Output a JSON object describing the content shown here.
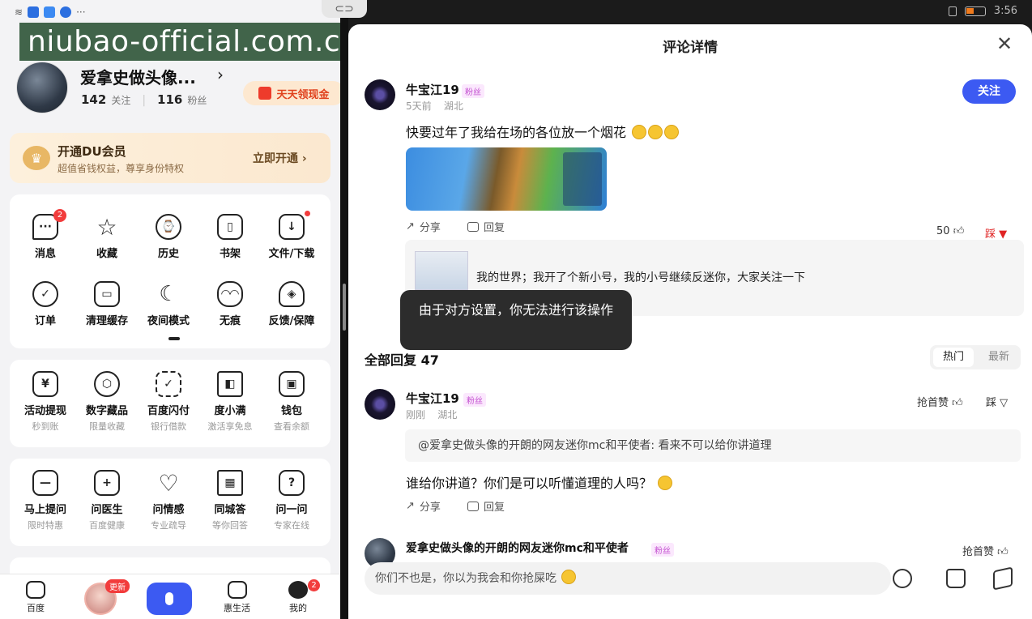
{
  "left": {
    "watermark": "niubao-official.com.cn",
    "profile": {
      "name": "爱拿史做头像...",
      "follow_count": "142",
      "follow_label": "关注",
      "fans_count": "116",
      "fans_label": "粉丝",
      "cash_label": "天天领现金"
    },
    "vip": {
      "title": "开通DU会员",
      "subtitle": "超值省钱权益，尊享身份特权",
      "button": "立即开通 ›"
    },
    "tools": [
      {
        "label": "消息",
        "icon": "message-icon",
        "badge": "2"
      },
      {
        "label": "收藏",
        "icon": "star-icon"
      },
      {
        "label": "历史",
        "icon": "clock-icon"
      },
      {
        "label": "书架",
        "icon": "bookshelf-icon"
      },
      {
        "label": "文件/下载",
        "icon": "download-icon",
        "dot": true
      },
      {
        "label": "订单",
        "icon": "order-icon"
      },
      {
        "label": "清理缓存",
        "icon": "clean-icon"
      },
      {
        "label": "夜间模式",
        "icon": "moon-icon"
      },
      {
        "label": "无痕",
        "icon": "mask-icon"
      },
      {
        "label": "反馈/保障",
        "icon": "feedback-icon"
      }
    ],
    "finance": [
      {
        "label": "活动提现",
        "sub": "秒到账",
        "icon": "withdraw-icon"
      },
      {
        "label": "数字藏品",
        "sub": "限量收藏",
        "icon": "cube-icon"
      },
      {
        "label": "百度闪付",
        "sub": "银行借款",
        "icon": "scan-icon"
      },
      {
        "label": "度小满",
        "sub": "激活享免息",
        "icon": "duxiaoman-icon"
      },
      {
        "label": "钱包",
        "sub": "查看余额",
        "icon": "wallet-icon"
      }
    ],
    "ask": [
      {
        "label": "马上提问",
        "sub": "限时特惠",
        "icon": "ask-icon"
      },
      {
        "label": "问医生",
        "sub": "百度健康",
        "icon": "doctor-icon"
      },
      {
        "label": "问情感",
        "sub": "专业疏导",
        "icon": "heart-icon"
      },
      {
        "label": "同城答",
        "sub": "等你回答",
        "icon": "building-icon"
      },
      {
        "label": "问一问",
        "sub": "专家在线",
        "icon": "question-icon"
      }
    ],
    "bottom_nav": {
      "home": "百度",
      "new_badge": "更新",
      "life": "惠生活",
      "mine": "我的",
      "mine_badge": "2"
    }
  },
  "status": {
    "time": "3:56"
  },
  "right": {
    "title": "评论详情",
    "post": {
      "author": "牛宝江19",
      "fan_tag": "粉丝",
      "time": "5天前",
      "location": "湖北",
      "follow_button": "关注",
      "text": "快要过年了我给在场的各位放一个烟花",
      "share": "分享",
      "reply": "回复",
      "likes": "50",
      "dislike": "踩",
      "quote": "我的世界；我开了个新小号，我的小号继续反迷你，大家关注一下"
    },
    "toast": "由于对方设置，你无法进行该操作",
    "all_replies_label": "全部回复",
    "all_replies_count": "47",
    "sort": {
      "hot": "热门",
      "new": "最新"
    },
    "reply1": {
      "author": "牛宝江19",
      "fan_tag": "粉丝",
      "time": "刚刚",
      "location": "湖北",
      "first_like": "抢首赞",
      "dislike": "踩",
      "quote": "@爱拿史做头像的开朗的网友迷你mc和平使者: 看来不可以给你讲道理",
      "text": "谁给你讲道？你们是可以听懂道理的人吗？",
      "share": "分享",
      "reply": "回复"
    },
    "reply2": {
      "author": "爱拿史做头像的开朗的网友迷你mc和平使者",
      "fan_tag": "粉丝",
      "first_like": "抢首赞"
    },
    "input": {
      "draft": "你们不也是，你以为我会和你抢屎吃"
    }
  }
}
